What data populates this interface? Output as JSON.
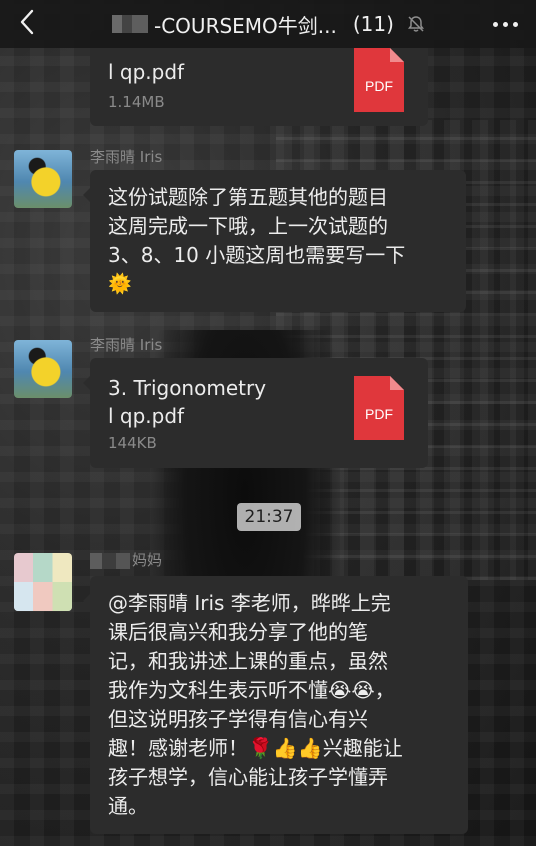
{
  "header": {
    "title": "-COURSEMO牛剑...",
    "count": "(11)",
    "back_icon": "chevron-left-icon",
    "mute_icon": "bell-slash-icon",
    "more_icon": "ellipsis-icon"
  },
  "messages": [
    {
      "type": "file",
      "file_name": "l qp.pdf",
      "file_size": "1.14MB",
      "badge": "PDF"
    },
    {
      "type": "text",
      "sender": "李雨晴 Iris",
      "lines": [
        "这份试题除了第五题其他的题目",
        "这周完成一下哦，上一次试题的",
        "3、8、10 小题这周也需要写一下"
      ],
      "emoji": "🌞"
    },
    {
      "type": "file",
      "sender": "李雨晴 Iris",
      "file_name": "3. Trigonometry\nl qp.pdf",
      "file_size": "144KB",
      "badge": "PDF"
    },
    {
      "type": "text",
      "sender": "妈妈",
      "lines": [
        "@李雨晴 Iris 李老师，晔晔上完",
        "课后很高兴和我分享了他的笔",
        "记，和我讲述上课的重点，虽然",
        "我作为文科生表示听不懂😭😭，",
        "但这说明孩子学得有信心有兴",
        "趣！感谢老师！🌹👍👍兴趣能让",
        "孩子想学，信心能让孩子学懂弄",
        "通。"
      ]
    }
  ],
  "timestamp": "21:37",
  "colors": {
    "bubble": "#2c2c2c",
    "pdf_red": "#e0373c",
    "header": "#181818"
  }
}
